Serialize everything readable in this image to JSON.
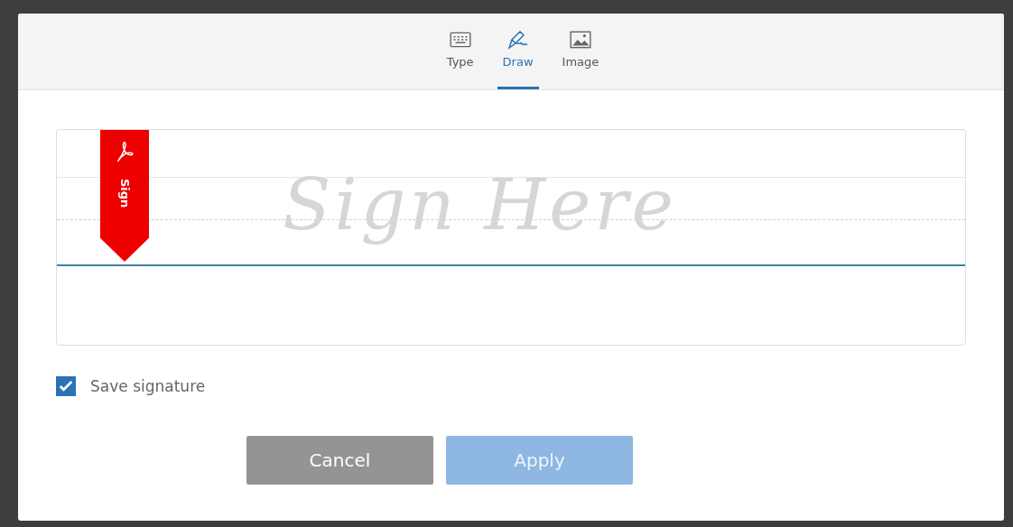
{
  "tabs": [
    {
      "label": "Type",
      "selected": false
    },
    {
      "label": "Draw",
      "selected": true
    },
    {
      "label": "Image",
      "selected": false
    }
  ],
  "signature_pad": {
    "placeholder": "Sign Here",
    "flag": "Sign"
  },
  "save_signature": {
    "label": "Save signature",
    "checked": true
  },
  "buttons": [
    {
      "label": "Cancel",
      "kind": "cancel",
      "disabled": false
    },
    {
      "label": "Apply",
      "kind": "apply",
      "disabled": true
    }
  ]
}
